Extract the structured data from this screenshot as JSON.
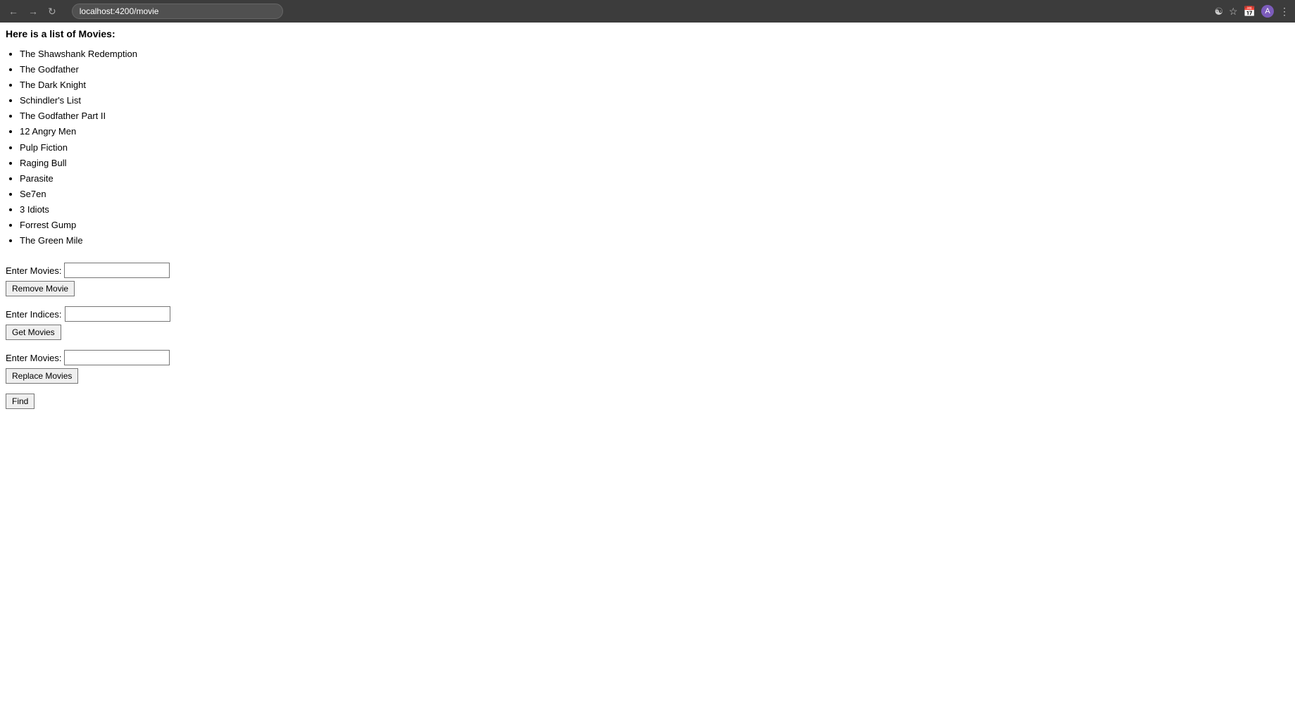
{
  "browser": {
    "url": "localhost:4200/movie",
    "back_btn": "←",
    "forward_btn": "→",
    "refresh_btn": "↻"
  },
  "page": {
    "title": "Here is a list of Movies:",
    "movies": [
      "The Shawshank Redemption",
      "The Godfather",
      "The Dark Knight",
      "Schindler's List",
      "The Godfather Part II",
      "12 Angry Men",
      "Pulp Fiction",
      "Raging Bull",
      "Parasite",
      "Se7en",
      "3 Idiots",
      "Forrest Gump",
      "The Green Mile"
    ],
    "remove_section": {
      "label": "Enter Movies:",
      "button": "Remove Movie"
    },
    "indices_section": {
      "label": "Enter Indices:",
      "button": "Get Movies"
    },
    "replace_section": {
      "label": "Enter Movies:",
      "button": "Replace Movies"
    },
    "find_button": "Find"
  }
}
